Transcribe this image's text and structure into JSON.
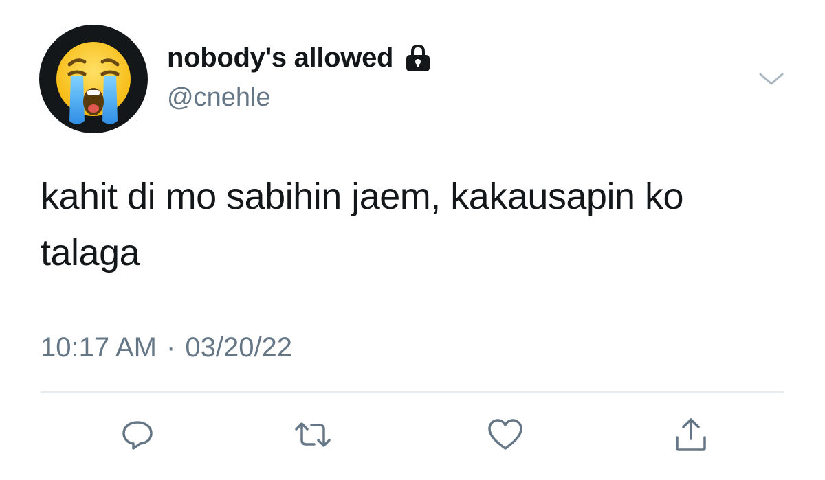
{
  "user": {
    "display_name": "nobody's allowed",
    "handle": "@cnehle",
    "avatar_icon": "loudly-crying-face-emoji",
    "protected_icon": "lock-icon"
  },
  "tweet": {
    "text": "kahit di mo sabihin jaem, kakausapin ko talaga",
    "time": "10:17 AM",
    "separator": "·",
    "date": "03/20/22"
  },
  "actions": [
    {
      "name": "reply",
      "icon": "reply-icon"
    },
    {
      "name": "retweet",
      "icon": "retweet-icon"
    },
    {
      "name": "like",
      "icon": "heart-icon"
    },
    {
      "name": "share",
      "icon": "share-icon"
    }
  ],
  "colors": {
    "text_primary": "#14171a",
    "text_secondary": "#657786",
    "icon_gray": "#657786",
    "divider": "#e6ecf0",
    "background": "#ffffff"
  }
}
